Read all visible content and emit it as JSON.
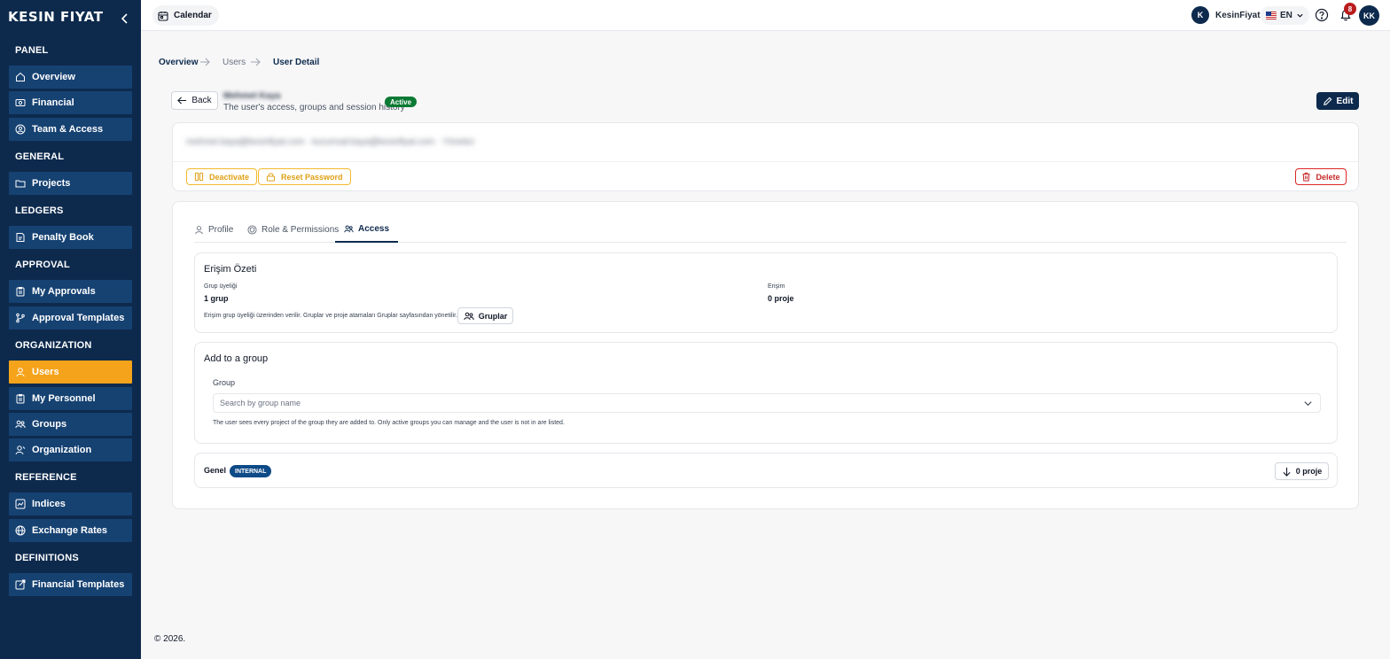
{
  "brand": {
    "logo": "KESIN FIYAT"
  },
  "sidebar": {
    "sections": [
      {
        "title": "PANEL",
        "items": [
          {
            "label": "Overview",
            "icon": "home-icon"
          },
          {
            "label": "Financial",
            "icon": "finance-icon"
          },
          {
            "label": "Team & Access",
            "icon": "team-icon"
          }
        ]
      },
      {
        "title": "GENERAL",
        "items": [
          {
            "label": "Projects",
            "icon": "folder-icon"
          }
        ]
      },
      {
        "title": "LEDGERS",
        "items": [
          {
            "label": "Penalty Book",
            "icon": "book-icon"
          }
        ]
      },
      {
        "title": "APPROVAL",
        "items": [
          {
            "label": "My Approvals",
            "icon": "clipboard-icon"
          },
          {
            "label": "Approval Templates",
            "icon": "branch-icon"
          }
        ]
      },
      {
        "title": "ORGANIZATION",
        "items": [
          {
            "label": "Users",
            "icon": "user-icon",
            "active": true
          },
          {
            "label": "My Personnel",
            "icon": "clipboard-icon"
          },
          {
            "label": "Groups",
            "icon": "groups-icon"
          },
          {
            "label": "Organization",
            "icon": "org-icon"
          }
        ]
      },
      {
        "title": "REFERENCE",
        "items": [
          {
            "label": "Indices",
            "icon": "chart-icon"
          },
          {
            "label": "Exchange Rates",
            "icon": "globe-icon"
          }
        ]
      },
      {
        "title": "DEFINITIONS",
        "items": [
          {
            "label": "Financial Templates",
            "icon": "template-icon"
          }
        ]
      }
    ]
  },
  "topbar": {
    "calendar_label": "Calendar",
    "tenant_initial": "K",
    "tenant_name": "KesinFiyat",
    "language": "EN",
    "notification_count": "8",
    "user_initials": "KK"
  },
  "breadcrumb": {
    "items": [
      "Overview",
      "Users",
      "User Detail"
    ]
  },
  "header": {
    "back_label": "Back",
    "user_name": "Mehmet Kaya",
    "subtitle": "The user's access, groups and session history",
    "status": "Active",
    "edit_label": "Edit"
  },
  "info": {
    "contact_line": "mehmet.kaya@kesinfiyat.com · kurumsal.kaya@kesinfiyat.com · Yönetici",
    "deactivate_label": "Deactivate",
    "reset_password_label": "Reset Password",
    "delete_label": "Delete"
  },
  "tabs": [
    {
      "label": "Profile",
      "icon": "user-icon"
    },
    {
      "label": "Role & Permissions",
      "icon": "shield-icon"
    },
    {
      "label": "Access",
      "icon": "groups-icon",
      "active": true
    }
  ],
  "access_summary": {
    "title": "Erişim Özeti",
    "group_label": "Grup üyeliği",
    "group_value": "1 grup",
    "access_label": "Erişim",
    "access_value": "0 proje",
    "note": "Erişim grup üyeliği üzerinden verilir. Gruplar ve proje atamaları Gruplar sayfasından yönetilir.",
    "groups_button": "Gruplar"
  },
  "add_group": {
    "title": "Add to a group",
    "field_label": "Group",
    "placeholder": "Search by group name",
    "help": "The user sees every project of the group they are added to. Only active groups you can manage and the user is not in are listed."
  },
  "group_row": {
    "name": "Genel",
    "tag": "INTERNAL",
    "projects_button": "0 proje"
  },
  "footer": {
    "text": "© 2026."
  },
  "colors": {
    "sidebar_bg": "#0d2a4d",
    "nav_item": "#164272",
    "accent": "#f5a31a",
    "success": "#0b7a34",
    "danger": "#c62828"
  }
}
